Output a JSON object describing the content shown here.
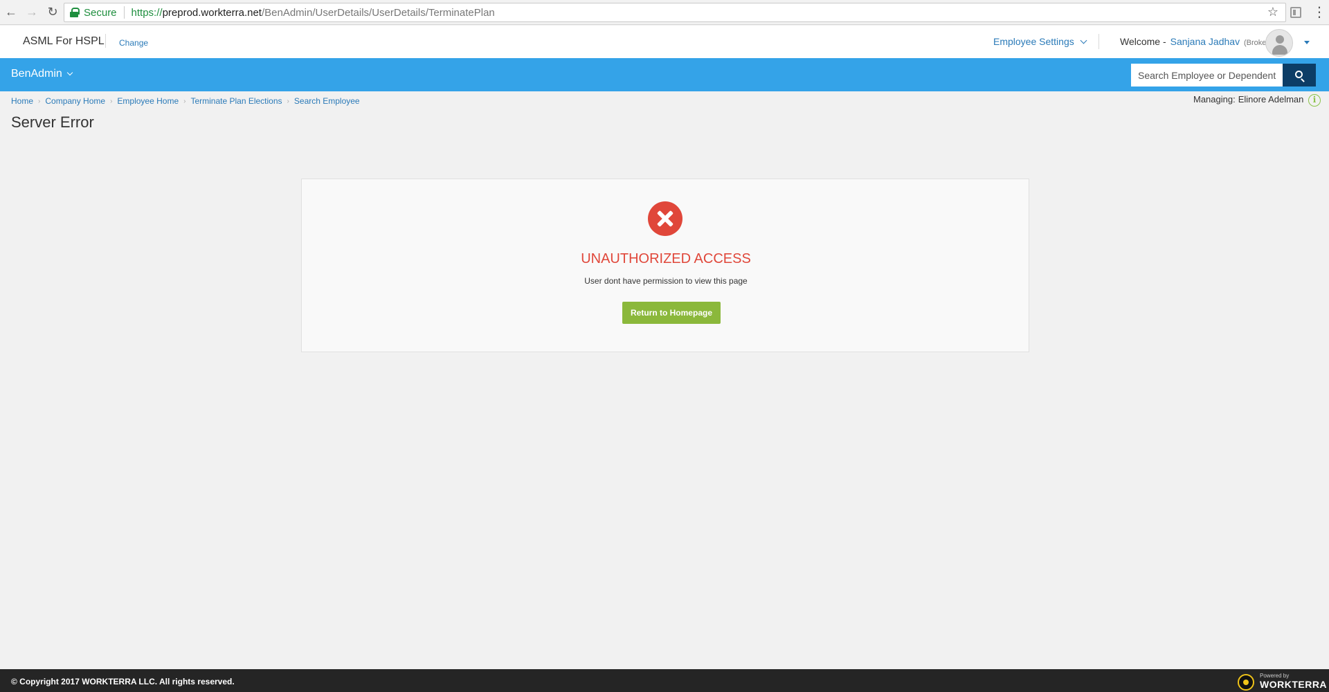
{
  "browser": {
    "secure_label": "Secure",
    "url_scheme": "https://",
    "url_host": "preprod.workterra.net",
    "url_path": "/BenAdmin/UserDetails/UserDetails/TerminatePlan"
  },
  "header": {
    "company": "ASML For HSPL",
    "change_label": "Change",
    "employee_settings": "Employee Settings",
    "welcome_label": "Welcome -",
    "user_name": "Sanjana Jadhav",
    "user_role": "(Broker)"
  },
  "nav": {
    "menu_label": "BenAdmin",
    "search_placeholder": "Search Employee or Dependent",
    "accent_color": "#34a3e8"
  },
  "breadcrumb": [
    "Home",
    "Company Home",
    "Employee Home",
    "Terminate Plan Elections",
    "Search Employee"
  ],
  "managing": {
    "label": "Managing:",
    "name": "Elinore Adelman"
  },
  "page": {
    "title": "Server Error"
  },
  "error": {
    "title": "UNAUTHORIZED ACCESS",
    "message": "User dont have permission to view this page",
    "button_label": "Return to Homepage",
    "icon": "error-x-icon",
    "color": "#e0473a"
  },
  "footer": {
    "copyright": "© Copyright 2017 WORKTERRA LLC. All rights reserved.",
    "powered_by": "Powered by",
    "brand": "WORKTERRA"
  }
}
